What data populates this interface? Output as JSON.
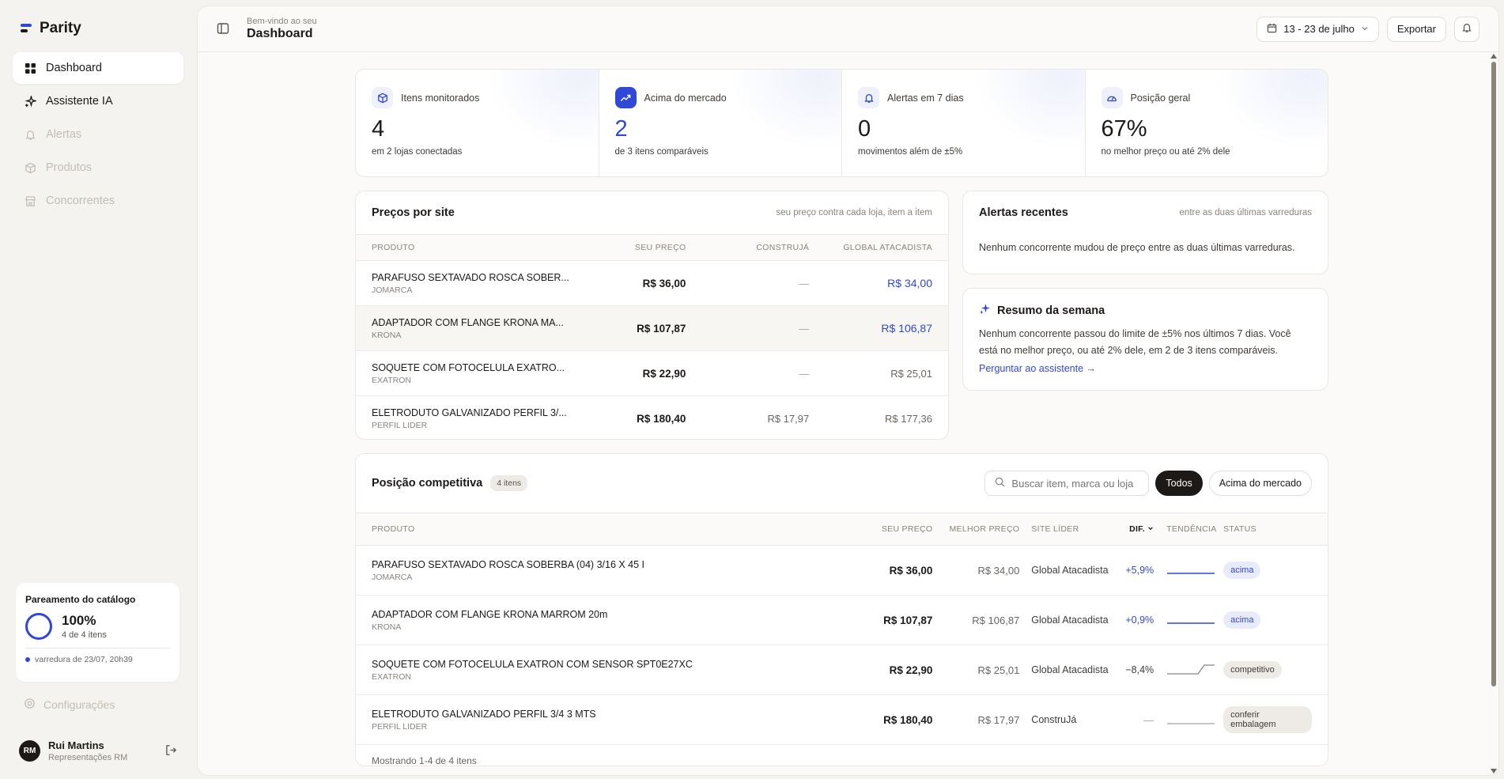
{
  "app": {
    "name": "Parity"
  },
  "sidebar": {
    "items": [
      {
        "label": "Dashboard",
        "icon": "dashboard-grid-icon",
        "active": true
      },
      {
        "label": "Assistente IA",
        "icon": "sparkle-icon"
      },
      {
        "label": "Alertas",
        "icon": "bell-icon",
        "disabled": true
      },
      {
        "label": "Produtos",
        "icon": "box-icon",
        "disabled": true
      },
      {
        "label": "Concorrentes",
        "icon": "store-icon",
        "disabled": true
      }
    ],
    "catalog": {
      "title": "Pareamento do catálogo",
      "percent": "100%",
      "sub": "4 de 4 itens",
      "scan": "varredura de 23/07, 20h39"
    },
    "settings": "Configurações",
    "user": {
      "initials": "RM",
      "name": "Rui Martins",
      "org": "Representações RM"
    }
  },
  "header": {
    "welcome": "Bem-vindo ao seu",
    "title": "Dashboard",
    "date_range": "13 - 23 de julho",
    "export": "Exportar"
  },
  "kpis": [
    {
      "label": "Itens monitorados",
      "value": "4",
      "sub": "em 2 lojas conectadas",
      "icon": "cube-icon"
    },
    {
      "label": "Acima do mercado",
      "value": "2",
      "sub": "de 3 itens comparáveis",
      "icon": "trending-up-icon"
    },
    {
      "label": "Alertas em 7 dias",
      "value": "0",
      "sub": "movimentos além de ±5%",
      "icon": "bell-icon"
    },
    {
      "label": "Posição geral",
      "value": "67%",
      "sub": "no melhor preço ou até 2% dele",
      "icon": "gauge-icon"
    }
  ],
  "prices": {
    "title": "Preços por site",
    "note": "seu preço contra cada loja, item a item",
    "columns": [
      "PRODUTO",
      "SEU PREÇO",
      "CONSTRUJÁ",
      "GLOBAL ATACADISTA"
    ],
    "rows": [
      {
        "name": "PARAFUSO SEXTAVADO ROSCA SOBER...",
        "brand": "JOMARCA",
        "mine": "R$ 36,00",
        "construja": "—",
        "global": "R$ 34,00"
      },
      {
        "name": "ADAPTADOR COM FLANGE KRONA MA...",
        "brand": "KRONA",
        "mine": "R$ 107,87",
        "construja": "—",
        "global": "R$ 106,87"
      },
      {
        "name": "SOQUETE COM FOTOCELULA EXATRO...",
        "brand": "EXATRON",
        "mine": "R$ 22,90",
        "construja": "—",
        "global": "R$ 25,01"
      },
      {
        "name": "ELETRODUTO GALVANIZADO PERFIL 3/...",
        "brand": "PERFIL LIDER",
        "mine": "R$ 180,40",
        "construja": "R$ 17,97",
        "global": "R$ 177,36"
      }
    ]
  },
  "alerts": {
    "title": "Alertas recentes",
    "note": "entre as duas últimas varreduras",
    "body": "Nenhum concorrente mudou de preço entre as duas últimas varreduras."
  },
  "summary": {
    "title": "Resumo da semana",
    "text": "Nenhum concorrente passou do limite de ±5% nos últimos 7 dias. Você está no melhor preço, ou até 2% dele, em 2 de 3 itens comparáveis.",
    "link": "Perguntar ao assistente →"
  },
  "competitive": {
    "title": "Posição competitiva",
    "count": "4 itens",
    "search_placeholder": "Buscar item, marca ou loja",
    "filters": [
      "Todos",
      "Acima do mercado"
    ],
    "columns": [
      "PRODUTO",
      "SEU PREÇO",
      "MELHOR PREÇO",
      "SITE LÍDER",
      "DIF.",
      "TENDÊNCIA",
      "STATUS"
    ],
    "rows": [
      {
        "name": "PARAFUSO SEXTAVADO ROSCA SOBERBA (04) 3/16 X 45 I",
        "brand": "JOMARCA",
        "mine": "R$ 36,00",
        "best": "R$ 34,00",
        "site": "Global Atacadista",
        "dif": "+5,9%",
        "status": "acima"
      },
      {
        "name": "ADAPTADOR COM FLANGE KRONA MARROM 20m",
        "brand": "KRONA",
        "mine": "R$ 107,87",
        "best": "R$ 106,87",
        "site": "Global Atacadista",
        "dif": "+0,9%",
        "status": "acima"
      },
      {
        "name": "SOQUETE COM FOTOCELULA EXATRON COM SENSOR SPT0E27XC",
        "brand": "EXATRON",
        "mine": "R$ 22,90",
        "best": "R$ 25,01",
        "site": "Global Atacadista",
        "dif": "−8,4%",
        "status": "competitivo"
      },
      {
        "name": "ELETRODUTO GALVANIZADO PERFIL 3/4 3 MTS",
        "brand": "PERFIL LIDER",
        "mine": "R$ 180,40",
        "best": "R$ 17,97",
        "site": "ConstruJá",
        "dif": "—",
        "status": "conferir embalagem"
      }
    ],
    "footer": "Mostrando 1-4 de 4 itens"
  },
  "colors": {
    "accent": "#3048d8",
    "ink": "#1c1917",
    "background": "#f5f3ef"
  }
}
